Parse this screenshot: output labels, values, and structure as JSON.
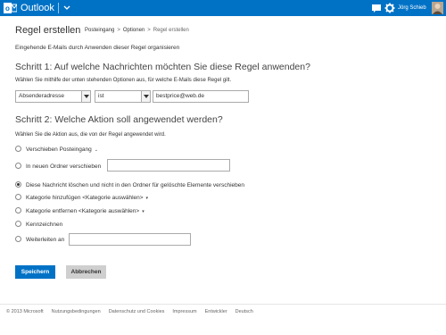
{
  "topbar": {
    "brand": "Outlook",
    "username": "Jörg Schieb",
    "colors": {
      "bar": "#0072c6"
    },
    "icons": [
      "outlook-logo-icon",
      "chevron-down-icon",
      "chat-icon",
      "gear-icon",
      "avatar"
    ]
  },
  "header": {
    "title": "Regel erstellen",
    "breadcrumb": [
      "Posteingang",
      "Optionen",
      "Regel erstellen"
    ],
    "separator": ">"
  },
  "subtitle": "Eingehende E-Mails durch Anwenden dieser Regel organisieren",
  "step1": {
    "title": "Schritt 1: Auf welche Nachrichten möchten Sie diese Regel anwenden?",
    "description": "Wählen Sie mithilfe der unten stehenden Optionen aus, für welche E-Mails diese Regel gilt.",
    "field_select": "Absenderadresse",
    "operator_select": "ist",
    "value_input": "bestprice@web.de"
  },
  "step2": {
    "title": "Schritt 2: Welche Aktion soll angewendet werden?",
    "description": "Wählen Sie die Aktion aus, die von der Regel angewendet wird.",
    "options": [
      {
        "label": "Verschieben Posteingang",
        "checked": false
      },
      {
        "label": "In neuen Ordner verschieben",
        "checked": false,
        "input_value": ""
      },
      {
        "label": "Diese Nachricht löschen und nicht in den Ordner für gelöschte Elemente verschieben",
        "checked": true
      },
      {
        "label": "Kategorie hinzufügen <Kategorie auswählen>",
        "checked": false
      },
      {
        "label": "Kategorie entfernen <Kategorie auswählen>",
        "checked": false
      },
      {
        "label": "Kennzeichnen",
        "checked": false
      },
      {
        "label": "Weiterleiten an",
        "checked": false,
        "input_value": ""
      }
    ]
  },
  "buttons": {
    "save": "Speichern",
    "cancel": "Abbrechen"
  },
  "footer": {
    "copyright": "© 2013 Microsoft",
    "links": [
      "Nutzungsbedingungen",
      "Datenschutz und Cookies",
      "Impressum",
      "Entwickler",
      "Deutsch"
    ]
  }
}
